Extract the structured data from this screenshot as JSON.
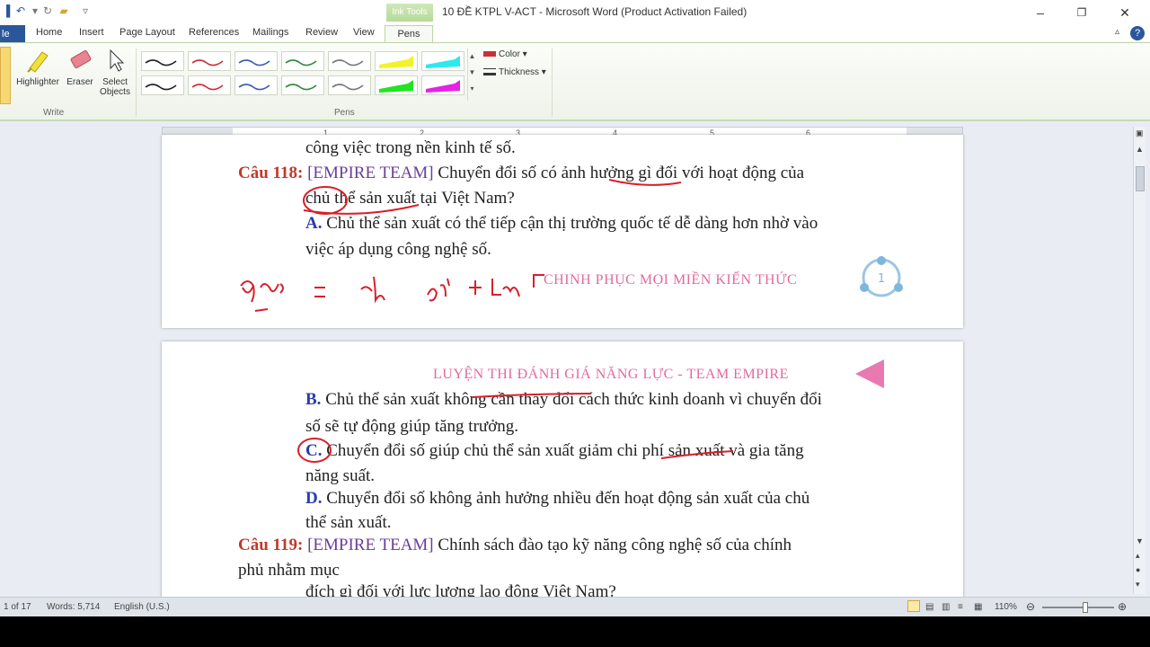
{
  "window": {
    "title": "10 ĐỀ KTPL V-ACT - Microsoft Word (Product Activation Failed)",
    "contextual_tab": "Ink Tools"
  },
  "tabs": [
    "le",
    "Home",
    "Insert",
    "Page Layout",
    "References",
    "Mailings",
    "Review",
    "View",
    "Pens"
  ],
  "ribbon": {
    "write_group": {
      "label": "Write",
      "buttons": [
        "Highlighter",
        "Eraser",
        "Select Objects"
      ]
    },
    "pens_group": {
      "label": "Pens"
    },
    "color_label": "Color",
    "thickness_label": "Thickness",
    "pen_colors": [
      "#222222",
      "#c8313b",
      "#3a5fb0",
      "#2e8b3a",
      "#777777",
      "#f2f22a",
      "#2ee8ee",
      "#222222",
      "#c8313b",
      "#3a5fb0",
      "#2e8b3a",
      "#777777",
      "#22e322",
      "#e422e4"
    ]
  },
  "ruler": {
    "numbers": [
      "1",
      "2",
      "3",
      "4",
      "5",
      "6"
    ]
  },
  "page1": {
    "top_line": "công việc trong nền kinh tế số.",
    "q_num": "Câu 118:",
    "q_team": "[EMPIRE TEAM]",
    "q_text_1": "Chuyển đổi số có ảnh hưởng gì đối với hoạt động của",
    "q_text_2": "chủ thể sản xuất tại Việt Nam?",
    "opt_a_label": "A.",
    "opt_a_text_1": "Chủ thể sản xuất có thể tiếp cận thị trường quốc tế dễ dàng hơn nhờ vào",
    "opt_a_text_2": "việc áp dụng công nghệ số.",
    "footer": "CHINH PHỤC MỌI MIỀN KIẾN THỨC",
    "page_num": "1"
  },
  "page2": {
    "header": "LUYỆN THI ĐÁNH GIÁ NĂNG LỰC - TEAM EMPIRE",
    "opt_b_label": "B.",
    "opt_b_text_1": "Chủ thể sản xuất không cần thay đổi cách thức kinh doanh vì chuyển đổi",
    "opt_b_text_2": "số sẽ tự động giúp tăng trưởng.",
    "opt_c_label": "C.",
    "opt_c_text_1": "Chuyển đổi số giúp chủ thể sản xuất giảm chi phí sản xuất và gia tăng",
    "opt_c_text_2": "năng suất.",
    "opt_d_label": "D.",
    "opt_d_text_1": "Chuyển đổi số không ảnh hưởng nhiều đến hoạt động sản xuất của chủ",
    "opt_d_text_2": "thể sản xuất.",
    "q2_num": "Câu 119:",
    "q2_team": "[EMPIRE TEAM]",
    "q2_text_1": "Chính sách đào tạo kỹ năng công nghệ số của chính",
    "q2_text_2": "phủ nhằm mục",
    "q2_text_3": "đích gì đối với lực lượng lao động Việt Nam?"
  },
  "status": {
    "page": "1 of 17",
    "words": "Words: 5,714",
    "language": "English (U.S.)",
    "zoom": "110%"
  }
}
